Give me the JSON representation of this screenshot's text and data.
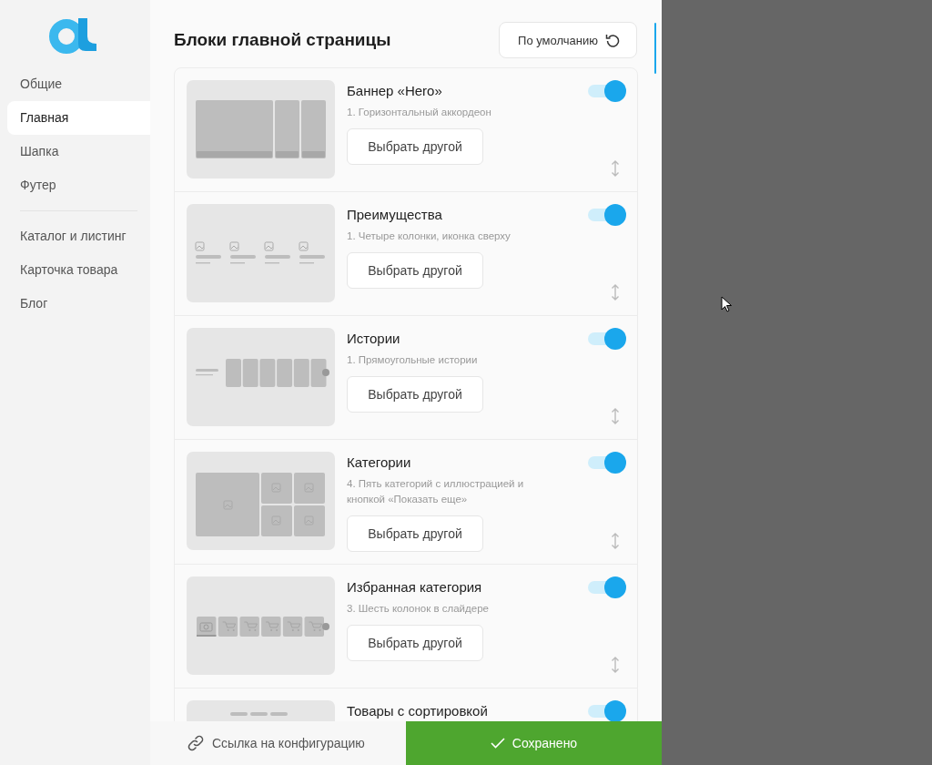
{
  "sidebar": {
    "groups": [
      {
        "items": [
          {
            "label": "Общие",
            "selected": false
          },
          {
            "label": "Главная",
            "selected": true
          },
          {
            "label": "Шапка",
            "selected": false
          },
          {
            "label": "Футер",
            "selected": false
          }
        ]
      },
      {
        "items": [
          {
            "label": "Каталог и листинг",
            "selected": false
          },
          {
            "label": "Карточка товара",
            "selected": false
          },
          {
            "label": "Блог",
            "selected": false
          }
        ]
      }
    ]
  },
  "header": {
    "title": "Блоки главной страницы",
    "reset_button": "По умолчанию"
  },
  "blocks": [
    {
      "kind": "hero",
      "title": "Баннер «Hero»",
      "subtitle": "1. Горизонтальный аккордеон",
      "button": "Выбрать другой",
      "on": true
    },
    {
      "kind": "features",
      "title": "Преимущества",
      "subtitle": "1. Четыре колонки, иконка сверху",
      "button": "Выбрать другой",
      "on": true
    },
    {
      "kind": "stories",
      "title": "Истории",
      "subtitle": "1. Прямоугольные истории",
      "button": "Выбрать другой",
      "on": true
    },
    {
      "kind": "categories",
      "title": "Категории",
      "subtitle": "4. Пять категорий с иллюстрацией и кнопкой «Показать еще»",
      "button": "Выбрать другой",
      "on": true
    },
    {
      "kind": "slider",
      "title": "Избранная категория",
      "subtitle": "3. Шесть колонок в слайдере",
      "button": "Выбрать другой",
      "on": true
    },
    {
      "kind": "sorting",
      "title": "Товары с сортировкой",
      "on": true
    }
  ],
  "footer": {
    "link": "Ссылка на конфигурацию",
    "save_button": "Сохранено"
  }
}
